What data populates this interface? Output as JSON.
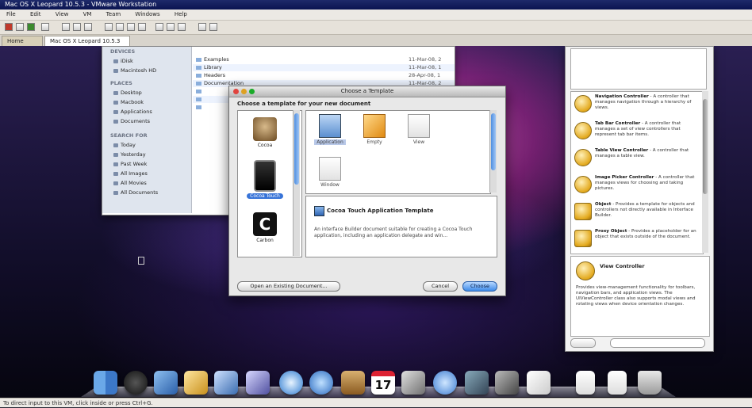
{
  "host": {
    "title": "Mac OS X Leopard 10.5.3 - VMware Workstation",
    "menu": [
      "File",
      "Edit",
      "View",
      "VM",
      "Team",
      "Windows",
      "Help"
    ],
    "tabs": [
      "Home",
      "Mac OS X Leopard 10.5.3"
    ],
    "status": "To direct input to this VM, click inside or press Ctrl+G."
  },
  "finder": {
    "devices": [
      "DEVICES"
    ],
    "sidebar_items": [
      "iDisk",
      "Macintosh HD"
    ],
    "places_head": "PLACES",
    "places": [
      "Desktop",
      "Macbook",
      "Applications",
      "Documents"
    ],
    "search_head": "SEARCH FOR",
    "search": [
      "Today",
      "Yesterday",
      "Past Week",
      "All Images",
      "All Movies",
      "All Documents"
    ],
    "files": [
      {
        "name": "Examples",
        "date": "11-Mar-08, 2"
      },
      {
        "name": "Library",
        "date": "11-Mar-08, 1"
      },
      {
        "name": "Headers",
        "date": "28-Apr-08, 1"
      },
      {
        "name": "Documentation",
        "date": "11-Mar-08, 2"
      },
      {
        "name": "",
        "date": ""
      },
      {
        "name": "",
        "date": ""
      },
      {
        "name": "",
        "date": ""
      }
    ]
  },
  "dialog": {
    "title": "Choose a Template",
    "prompt": "Choose a template for your new document",
    "categories": [
      {
        "label": "Cocoa",
        "icon": "cocoa-cup-icon"
      },
      {
        "label": "Cocoa Touch",
        "icon": "iphone-icon"
      },
      {
        "label": "Carbon",
        "icon": "carbon-c-icon"
      }
    ],
    "templates": [
      "Application",
      "Empty",
      "View",
      "Window"
    ],
    "desc_title": "Cocoa Touch Application Template",
    "desc_body": "An interface Builder document suitable for creating a Cocoa Touch application, including an application delegate and win...",
    "open_existing": "Open an Existing Document...",
    "cancel": "Cancel",
    "choose": "Choose"
  },
  "library": {
    "items": [
      {
        "title": "Navigation Controller",
        "body": "- A controller that manages navigation through a hierarchy of views."
      },
      {
        "title": "Tab Bar Controller",
        "body": "- A controller that manages a set of view controllers that represent tab bar items."
      },
      {
        "title": "Table View Controller",
        "body": "- A controller that manages a table view."
      },
      {
        "title": "Image Picker Controller",
        "body": "- A controller that manages views for choosing and taking pictures."
      },
      {
        "title": "Object",
        "body": "- Provides a template for objects and controllers not directly available in Interface Builder."
      },
      {
        "title": "Proxy Object",
        "body": "- Provides a placeholder for an object that exists outside of the document."
      }
    ],
    "detail_title": "View Controller",
    "detail_body": "Provides view-management functionality for toolbars, navigation bars, and application views. The UIViewController class also supports modal views and rotating views when device orientation changes."
  },
  "dock": {
    "icons": [
      "finder-icon",
      "dashboard-icon",
      "xcode-icon",
      "preview-icon",
      "mail-icon",
      "photo-icon",
      "safari-icon",
      "ichat-icon",
      "address-book-icon",
      "ical-icon",
      "photos-icon",
      "itunes-icon",
      "spaces-icon",
      "time-machine-icon",
      "textedit-icon",
      "doc-icon",
      "doc2-icon",
      "trash-icon"
    ],
    "calendar_day": "17"
  }
}
